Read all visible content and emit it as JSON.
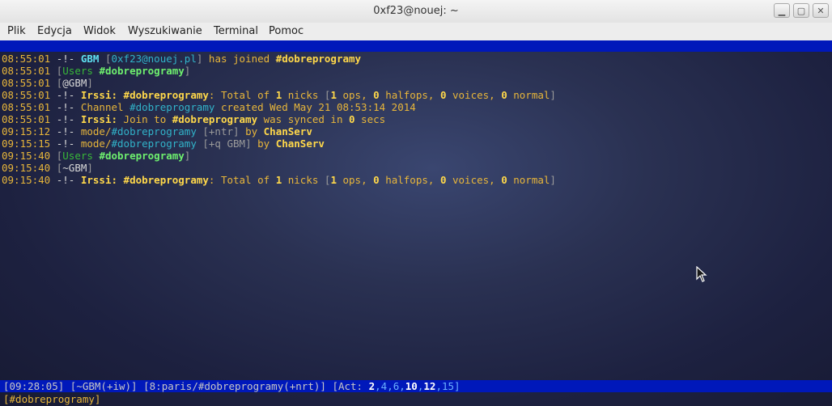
{
  "window": {
    "title": "0xf23@nouej: ~",
    "btn_min": "▁",
    "btn_max": "▢",
    "btn_close": "✕"
  },
  "menu": [
    "Plik",
    "Edycja",
    "Widok",
    "Wyszukiwanie",
    "Terminal",
    "Pomoc"
  ],
  "log": [
    {
      "time": "08:55:01",
      "segs": [
        [
          "w",
          " -!- "
        ],
        [
          "cb",
          "GBM"
        ],
        [
          "br",
          " ["
        ],
        [
          "c",
          "0xf23@nouej.pl"
        ],
        [
          "br",
          "]"
        ],
        [
          "y",
          " has joined "
        ],
        [
          "yb",
          "#dobreprogramy"
        ]
      ]
    },
    {
      "time": "08:55:01",
      "segs": [
        [
          "br",
          " ["
        ],
        [
          "g",
          "Users "
        ],
        [
          "gb",
          "#dobreprogramy"
        ],
        [
          "br",
          "]"
        ]
      ]
    },
    {
      "time": "08:55:01",
      "segs": [
        [
          "br",
          " ["
        ],
        [
          "w",
          "@GBM"
        ],
        [
          "br",
          "]"
        ]
      ]
    },
    {
      "time": "08:55:01",
      "segs": [
        [
          "w",
          " -!- "
        ],
        [
          "yb",
          "Irssi: #dobreprogramy"
        ],
        [
          "y",
          ": Total of "
        ],
        [
          "yb",
          "1"
        ],
        [
          "y",
          " nicks "
        ],
        [
          "br",
          "["
        ],
        [
          "yb",
          "1"
        ],
        [
          "y",
          " ops, "
        ],
        [
          "yb",
          "0"
        ],
        [
          "y",
          " halfops, "
        ],
        [
          "yb",
          "0"
        ],
        [
          "y",
          " voices, "
        ],
        [
          "yb",
          "0"
        ],
        [
          "y",
          " normal"
        ],
        [
          "br",
          "]"
        ]
      ]
    },
    {
      "time": "08:55:01",
      "segs": [
        [
          "w",
          " -!- "
        ],
        [
          "y",
          "Channel "
        ],
        [
          "c",
          "#dobreprogramy"
        ],
        [
          "y",
          " created Wed May 21 08:53:14 2014"
        ]
      ]
    },
    {
      "time": "08:55:01",
      "segs": [
        [
          "w",
          " -!- "
        ],
        [
          "yb",
          "Irssi:"
        ],
        [
          "y",
          " Join to "
        ],
        [
          "yb",
          "#dobreprogramy"
        ],
        [
          "y",
          " was synced in "
        ],
        [
          "yb",
          "0"
        ],
        [
          "y",
          " secs"
        ]
      ]
    },
    {
      "time": "09:15:12",
      "segs": [
        [
          "w",
          " -!- "
        ],
        [
          "y",
          "mode/"
        ],
        [
          "c",
          "#dobreprogramy"
        ],
        [
          "br",
          " [+ntr]"
        ],
        [
          "y",
          " by "
        ],
        [
          "yb",
          "ChanServ"
        ]
      ]
    },
    {
      "time": "09:15:15",
      "segs": [
        [
          "w",
          " -!- "
        ],
        [
          "y",
          "mode/"
        ],
        [
          "c",
          "#dobreprogramy"
        ],
        [
          "br",
          " [+q GBM]"
        ],
        [
          "y",
          " by "
        ],
        [
          "yb",
          "ChanServ"
        ]
      ]
    },
    {
      "time": "09:15:40",
      "segs": [
        [
          "br",
          " ["
        ],
        [
          "g",
          "Users "
        ],
        [
          "gb",
          "#dobreprogramy"
        ],
        [
          "br",
          "]"
        ]
      ]
    },
    {
      "time": "09:15:40",
      "segs": [
        [
          "br",
          " ["
        ],
        [
          "w",
          "~GBM"
        ],
        [
          "br",
          "]"
        ]
      ]
    },
    {
      "time": "09:15:40",
      "segs": [
        [
          "w",
          " -!- "
        ],
        [
          "yb",
          "Irssi: #dobreprogramy"
        ],
        [
          "y",
          ": Total of "
        ],
        [
          "yb",
          "1"
        ],
        [
          "y",
          " nicks "
        ],
        [
          "br",
          "["
        ],
        [
          "yb",
          "1"
        ],
        [
          "y",
          " ops, "
        ],
        [
          "yb",
          "0"
        ],
        [
          "y",
          " halfops, "
        ],
        [
          "yb",
          "0"
        ],
        [
          "y",
          " voices, "
        ],
        [
          "yb",
          "0"
        ],
        [
          "y",
          " normal"
        ],
        [
          "br",
          "]"
        ]
      ]
    }
  ],
  "status": {
    "time": "[09:28:05]",
    "nick": "[~GBM(+iw)]",
    "window": "[8:paris/#dobreprogramy(+nrt)]",
    "act_label": "[Act: ",
    "act": [
      [
        "sw",
        "2"
      ],
      [
        "sc",
        ","
      ],
      [
        "sc",
        "4"
      ],
      [
        "sc",
        ","
      ],
      [
        "sc",
        "6"
      ],
      [
        "sc",
        ","
      ],
      [
        "sw",
        "10"
      ],
      [
        "sc",
        ","
      ],
      [
        "sw",
        "12"
      ],
      [
        "sc",
        ","
      ],
      [
        "sc",
        "15"
      ],
      [
        "sc",
        "]"
      ]
    ]
  },
  "input": "[#dobreprogramy]",
  "colors": {
    "bar_blue": "#0018ba",
    "timestamp": "#e8b63a",
    "channel_cyan": "#31b3c9"
  }
}
